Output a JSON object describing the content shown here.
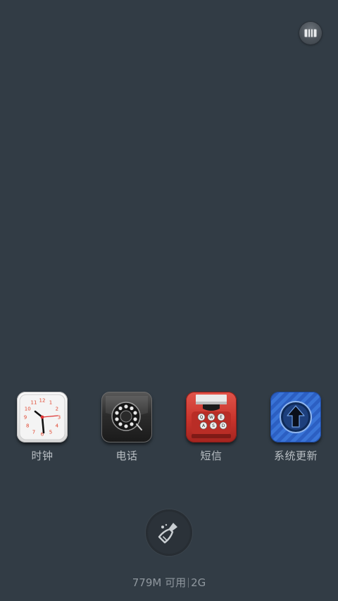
{
  "apps": [
    {
      "id": "clock",
      "label": "时钟",
      "icon": "clock-icon"
    },
    {
      "id": "phone",
      "label": "电话",
      "icon": "rotary-phone-icon"
    },
    {
      "id": "messages",
      "label": "短信",
      "icon": "typewriter-icon"
    },
    {
      "id": "system-update",
      "label": "系统更新",
      "icon": "upload-arrow-icon"
    }
  ],
  "clock_face_numbers": [
    "12",
    "1",
    "2",
    "3",
    "4",
    "5",
    "6",
    "7",
    "8",
    "9",
    "10",
    "11"
  ],
  "typewriter_keys": [
    "Q",
    "W",
    "E",
    "A",
    "S",
    "D"
  ],
  "memory": {
    "available": "779M 可用",
    "total": "2G"
  },
  "colors": {
    "background": "#323c45",
    "label": "#b9bfc4",
    "memory_text": "#8f979e",
    "clock_accent": "#e0452e",
    "typewriter_red": "#c8342c",
    "update_blue": "#2f64c9"
  }
}
